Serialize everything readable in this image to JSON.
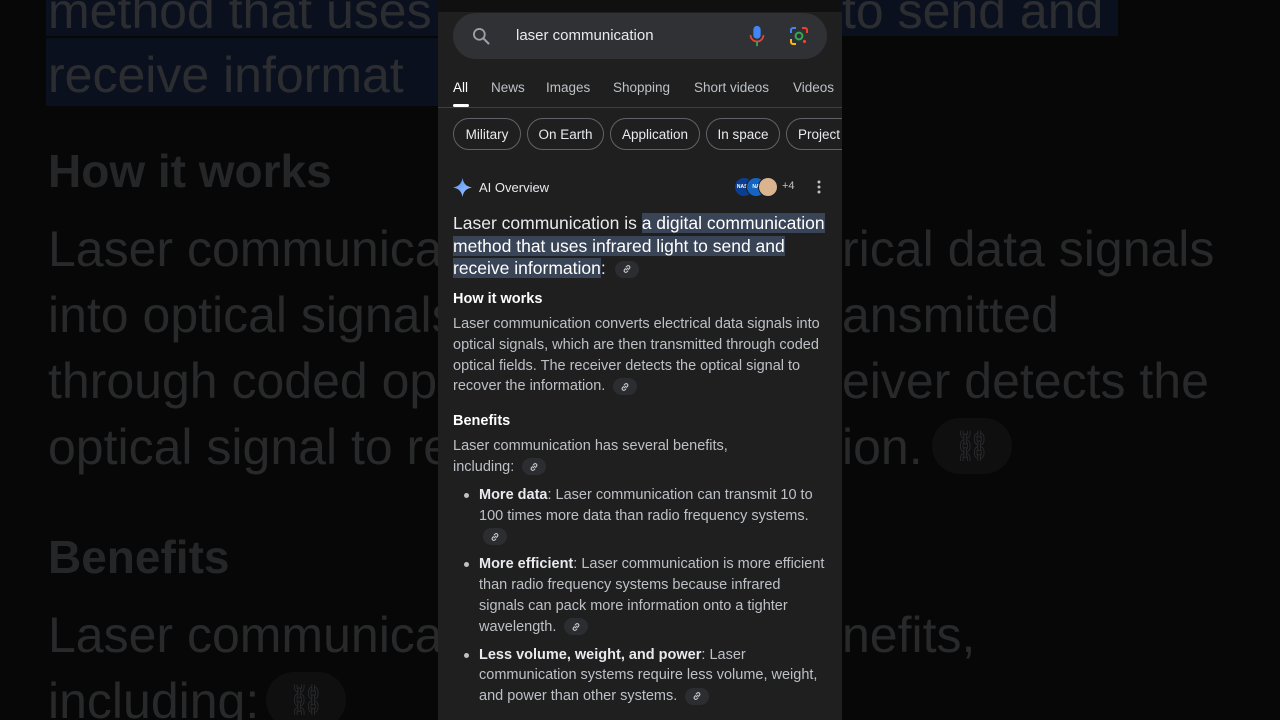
{
  "background": {
    "lines": [
      "method that uses",
      "to send and",
      "receive informat",
      "How it works",
      "Laser communicat",
      "rical data signals",
      "into optical signals",
      "ansmitted",
      "through coded op",
      "eiver detects the",
      "optical signal to re",
      "ion.",
      "Benefits",
      "Laser communicat",
      "nefits,",
      "including:"
    ]
  },
  "search": {
    "query": "laser communication"
  },
  "tabs": [
    "All",
    "News",
    "Images",
    "Shopping",
    "Short videos",
    "Videos"
  ],
  "chips": [
    "Military",
    "On Earth",
    "Application",
    "In space",
    "Project"
  ],
  "ai_overview": {
    "label": "AI Overview",
    "source_avatars": [
      "NASA",
      "NA",
      ""
    ],
    "more_sources": "+4",
    "lead_plain": "Laser communication is ",
    "lead_highlight": "a digital communication method that uses infrared light to send and receive information",
    "lead_end": ":",
    "section1_title": "How it works",
    "section1_text": "Laser communication converts electrical data signals into optical signals, which are then transmitted through coded optical fields. The receiver detects the optical signal to recover the information.",
    "section2_title": "Benefits",
    "section2_text": "Laser communication has several benefits, including:",
    "bullets": [
      {
        "bold": "More data",
        "text": ": Laser communication can transmit 10 to 100 times more data than radio frequency systems."
      },
      {
        "bold": "More efficient",
        "text": ": Laser communication is more efficient than radio frequency systems because infrared signals can pack more information onto a tighter wavelength."
      },
      {
        "bold": "Less volume, weight, and power",
        "text": ": Laser communication systems require less volume, weight, and power than other systems."
      }
    ]
  }
}
